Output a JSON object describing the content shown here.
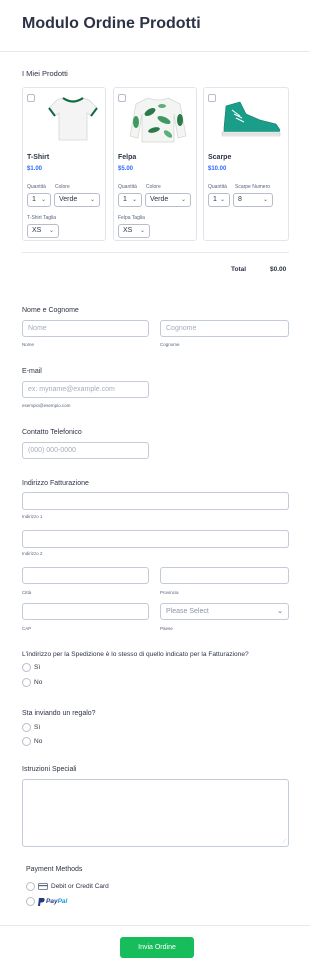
{
  "header": {
    "title": "Modulo Ordine Prodotti"
  },
  "products": {
    "section_label": "I Miei Prodotti",
    "items": [
      {
        "name": "T-Shirt",
        "price": "$1.00",
        "qty_label": "Quantità",
        "qty_value": "1",
        "color_label": "Colore",
        "color_value": "Verde",
        "size_label": "T-Shirt Taglia",
        "size_value": "XS"
      },
      {
        "name": "Felpa",
        "price": "$5.00",
        "qty_label": "Quantità",
        "qty_value": "1",
        "color_label": "Colore",
        "color_value": "Verde",
        "size_label": "Felpa Taglia",
        "size_value": "XS"
      },
      {
        "name": "Scarpe",
        "price": "$10.00",
        "qty_label": "Quantità",
        "qty_value": "1",
        "number_label": "Scarpe Numero",
        "number_value": "8"
      }
    ],
    "total_label": "Total",
    "total_value": "$0.00"
  },
  "name_field": {
    "label": "Nome e Cognome",
    "first_placeholder": "Nome",
    "last_placeholder": "Cognome",
    "first_sub": "Nome",
    "last_sub": "Cognome"
  },
  "email_field": {
    "label": "E-mail",
    "placeholder": "ex: myname@example.com",
    "sub": "esempio@esempio.com"
  },
  "phone_field": {
    "label": "Contatto Telefonico",
    "placeholder": "(000) 000-0000"
  },
  "address": {
    "label": "Indirizzo Fatturazione",
    "line1_sub": "Indirizzo 1",
    "line2_sub": "Indirizzo 2",
    "city_sub": "Città",
    "province_sub": "Provincia",
    "cap_sub": "CAP",
    "country_sub": "Paese",
    "country_placeholder": "Please Select"
  },
  "same_address": {
    "question": "L'indirizzo per la Spedizione è lo stesso di quello indicato per la Fatturazione?",
    "options": [
      "Sì",
      "No"
    ]
  },
  "gift": {
    "question": "Sta inviando un regalo?",
    "options": [
      "Sì",
      "No"
    ]
  },
  "instructions": {
    "label": "Istruzioni Speciali"
  },
  "payment": {
    "label": "Payment Methods",
    "card_label": "Debit or Credit Card",
    "paypal_pay": "Pay",
    "paypal_pal": "Pal"
  },
  "submit": {
    "label": "Invia Ordine"
  },
  "colors": {
    "accent_green": "#18bd5b",
    "price_blue": "#2e69ff",
    "shoe_teal": "#1a9e8a",
    "tshirt_trim": "#0f6b3f",
    "paypal_dark": "#253b80",
    "paypal_light": "#179bd7"
  }
}
